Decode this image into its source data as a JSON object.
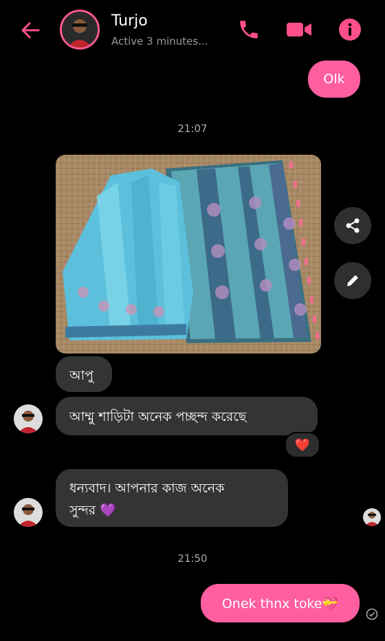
{
  "header": {
    "name": "Turjo",
    "status": "Active 3 minutes...",
    "icons": [
      "back-arrow-icon",
      "phone-icon",
      "video-camera-icon",
      "info-icon"
    ]
  },
  "messages": {
    "sent_1": "Olk",
    "timestamp_1": "21:07",
    "photo_description": "shared-photo",
    "received_1": "আপু",
    "received_2": "আম্মু শাড়িটা অনেক পচ্ছন্দ করেছে",
    "reaction": "❤️",
    "received_3_line1": "ধন্যবাদ। আপনার কাজ অনেক",
    "received_3_line2": "সুন্দর 💜",
    "timestamp_2": "21:50",
    "sent_2": "Onek thnx toke💝"
  },
  "colors": {
    "accent": "#ff5ea0",
    "background": "#000000",
    "incoming_bubble": "#343434"
  }
}
